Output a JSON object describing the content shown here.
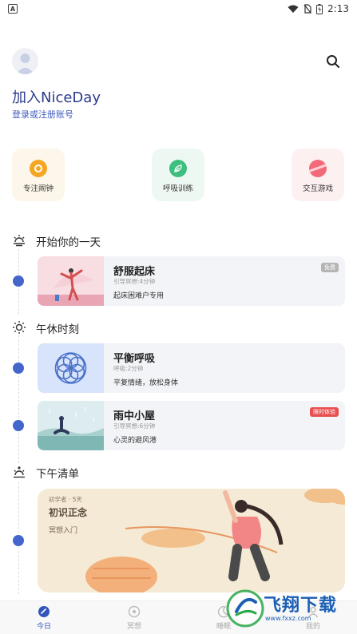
{
  "status_bar": {
    "notification_icon": "A",
    "time": "2:13"
  },
  "profile": {
    "title": "加入NiceDay",
    "login_link": "登录或注册账号"
  },
  "features": [
    {
      "label": "专注闹钟",
      "icon": "focus-alarm-icon",
      "color": "#f5a623"
    },
    {
      "label": "呼吸训练",
      "icon": "breathing-leaf-icon",
      "color": "#3fbf7f"
    },
    {
      "label": "交互游戏",
      "icon": "game-planet-icon",
      "color": "#f26a7a"
    }
  ],
  "sections": [
    {
      "title": "开始你的一天",
      "icon": "sunrise-icon"
    },
    {
      "title": "午休时刻",
      "icon": "sun-icon"
    },
    {
      "title": "下午清单",
      "icon": "sunset-icon"
    }
  ],
  "cards": [
    {
      "title": "舒服起床",
      "meta": "引导冥想:4分钟",
      "desc": "起床困难户专用",
      "badge": "免费",
      "badge_color": "#aaaaaa"
    },
    {
      "title": "平衡呼吸",
      "meta": "呼吸:2分钟",
      "desc": "平复情绪，放松身体",
      "badge": "",
      "badge_color": ""
    },
    {
      "title": "雨中小屋",
      "meta": "引导冥想:6分钟",
      "desc": "心灵的避风港",
      "badge": "限时体验",
      "badge_color": "#e85050"
    }
  ],
  "big_card": {
    "meta": "初学者 · 5天",
    "title": "初识正念",
    "subtitle": "冥想入门"
  },
  "tabs": [
    {
      "label": "今日",
      "icon": "today-icon",
      "active": true
    },
    {
      "label": "冥想",
      "icon": "meditation-icon",
      "active": false
    },
    {
      "label": "睡眠",
      "icon": "sleep-moon-icon",
      "active": false
    },
    {
      "label": "我的",
      "icon": "profile-icon",
      "active": false
    }
  ],
  "watermark": {
    "brand": "飞翔下载",
    "url": "www.fxxz.com"
  },
  "colors": {
    "accent": "#4466cc",
    "title_blue": "#2b3a8a"
  }
}
